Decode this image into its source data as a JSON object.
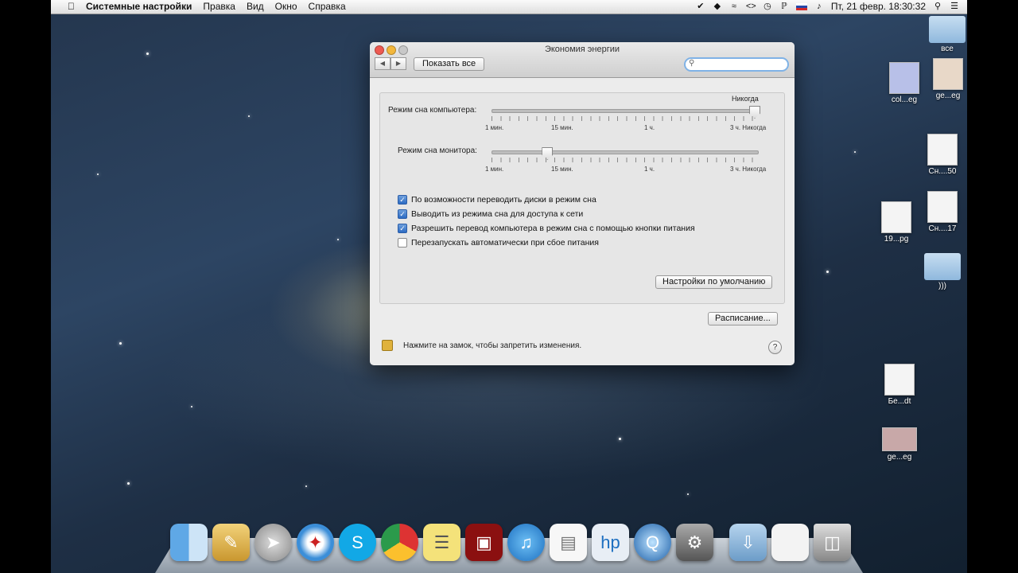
{
  "menubar": {
    "apple": "",
    "app_name": "Системные настройки",
    "items": [
      "Правка",
      "Вид",
      "Окно",
      "Справка"
    ],
    "status": {
      "datetime": "Пт, 21 февр.  18:30:32"
    }
  },
  "window": {
    "title": "Экономия энергии",
    "show_all": "Показать все",
    "search_placeholder": "",
    "computer_sleep": {
      "label": "Режим сна компьютера:",
      "value_label": "Никогда",
      "level": 1.0,
      "ticks": [
        "1 мин.",
        "15 мин.",
        "1 ч.",
        "3 ч. Никогда"
      ]
    },
    "display_sleep": {
      "label": "Режим сна монитора:",
      "level": 0.21,
      "ticks": [
        "1 мин.",
        "15 мин.",
        "1 ч.",
        "3 ч. Никогда"
      ]
    },
    "checkboxes": [
      {
        "label": "По возможности переводить диски в режим сна",
        "checked": true
      },
      {
        "label": "Выводить из режима сна для доступа к сети",
        "checked": true
      },
      {
        "label": "Разрешить перевод компьютера в режим сна с помощью кнопки питания",
        "checked": true
      },
      {
        "label": "Перезапускать автоматически при сбое питания",
        "checked": false
      }
    ],
    "restore_defaults": "Настройки по умолчанию",
    "schedule": "Расписание...",
    "lock_text": "Нажмите на замок, чтобы запретить изменения.",
    "help": "?"
  },
  "desktop": [
    {
      "label": "все",
      "kind": "folder"
    },
    {
      "label": "col...eg",
      "kind": "image"
    },
    {
      "label": "ge...eg",
      "kind": "image"
    },
    {
      "label": "Сн....50",
      "kind": "doc"
    },
    {
      "label": "Сн....17",
      "kind": "doc"
    },
    {
      "label": "19...pg",
      "kind": "image"
    },
    {
      "label": ")))",
      "kind": "folder"
    },
    {
      "label": "Бе...dt",
      "kind": "doc"
    },
    {
      "label": "ge...eg",
      "kind": "image"
    }
  ],
  "dock": [
    "Finder",
    "Preview",
    "Launchpad",
    "Safari",
    "Skype",
    "Chrome",
    "Stickies",
    "Photo Booth",
    "iTunes",
    "TextEdit",
    "HP",
    "QuickTime",
    "System Preferences",
    "Downloads",
    "Stack",
    "Trash"
  ]
}
